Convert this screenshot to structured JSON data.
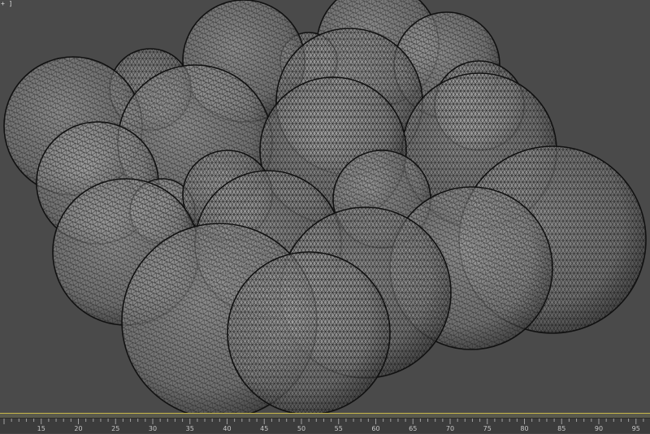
{
  "viewport": {
    "corner_label": "+ ]",
    "background_color": "#4a4a4a",
    "wire_color": "#111111",
    "sphere_fill": "#9a9a9a",
    "object": "wireframe-sphere-cluster"
  },
  "timeline": {
    "track_color": "#c8b84a",
    "ticks": [
      "15",
      "20",
      "25",
      "30",
      "35",
      "40",
      "45",
      "50",
      "55",
      "60",
      "65",
      "70",
      "75",
      "80",
      "85",
      "90",
      "95"
    ]
  }
}
